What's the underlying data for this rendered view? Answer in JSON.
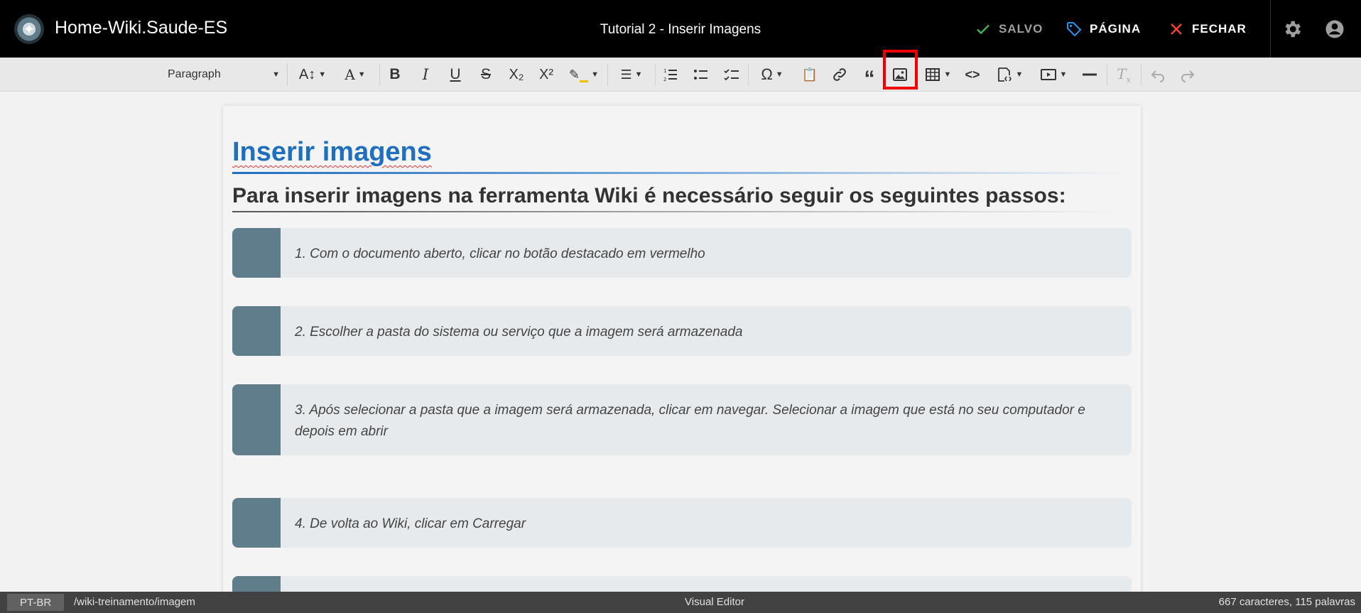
{
  "header": {
    "site_title": "Home-Wiki.Saude-ES",
    "page_title": "Tutorial 2 - Inserir Imagens",
    "saved_label": "SALVO",
    "page_label": "PÁGINA",
    "close_label": "FECHAR"
  },
  "toolbar": {
    "paragraph_select": "Paragraph",
    "buttons": [
      "font-size",
      "font-family",
      "bold",
      "italic",
      "underline",
      "strikethrough",
      "subscript",
      "superscript",
      "highlight",
      "alignment",
      "numbered-list",
      "bulleted-list",
      "todo-list",
      "special-characters",
      "paste-from-office",
      "link",
      "blockquote",
      "insert-image",
      "insert-table",
      "code-block",
      "insert-html",
      "media-embed",
      "horizontal-line",
      "remove-format",
      "undo",
      "redo"
    ],
    "highlighted_button": "insert-image"
  },
  "document": {
    "heading1": "Inserir imagens",
    "heading2": "Para inserir imagens na ferramenta Wiki é necessário seguir os seguintes passos:",
    "steps": [
      "1. Com o documento aberto, clicar no botão destacado em vermelho",
      "2. Escolher a pasta do sistema ou serviço que a imagem será armazenada",
      "3. Após selecionar a pasta que a imagem será armazenada, clicar em navegar. Selecionar a imagem que está no seu computador e depois em abrir",
      "4. De volta ao Wiki, clicar em Carregar"
    ]
  },
  "footer": {
    "language": "PT-BR",
    "path": "/wiki-treinamento/imagem",
    "mode": "Visual Editor",
    "count": "667 caracteres, 115 palavras"
  },
  "colors": {
    "header_bg": "#000000",
    "heading_blue": "#1e6fc0",
    "step_bar": "#607d8b",
    "highlight_red": "#ee0000",
    "saved_green": "#4caf50",
    "page_blue": "#2196f3",
    "close_red": "#f44336"
  }
}
